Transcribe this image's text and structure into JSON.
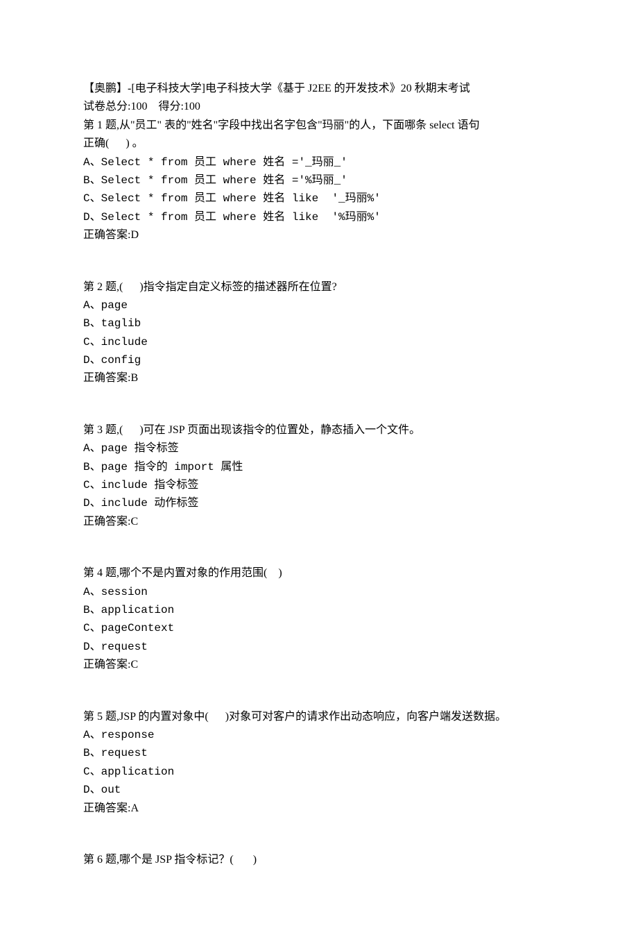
{
  "header": {
    "title": "【奥鹏】-[电子科技大学]电子科技大学《基于 J2EE 的开发技术》20 秋期末考试",
    "score_line": "试卷总分:100    得分:100"
  },
  "questions": [
    {
      "prompt_lines": [
        "第 1 题,从\"员工\" 表的\"姓名\"字段中找出名字包含\"玛丽\"的人，下面哪条 select 语句",
        "正确(      ) 。"
      ],
      "options": [
        "A、Select * from 员工 where 姓名 ='_玛丽_'",
        "B、Select * from 员工 where 姓名 ='%玛丽_'",
        "C、Select * from 员工 where 姓名 like  '_玛丽%'",
        "D、Select * from 员工 where 姓名 like  '%玛丽%'"
      ],
      "answer": "正确答案:D"
    },
    {
      "prompt_lines": [
        "第 2 题,(      )指令指定自定义标签的描述器所在位置?"
      ],
      "options": [
        "A、page",
        "B、taglib",
        "C、include",
        "D、config"
      ],
      "answer": "正确答案:B"
    },
    {
      "prompt_lines": [
        "第 3 题,(      )可在 JSP 页面出现该指令的位置处，静态插入一个文件。"
      ],
      "options": [
        "A、page 指令标签",
        "B、page 指令的 import 属性",
        "C、include 指令标签",
        "D、include 动作标签"
      ],
      "answer": "正确答案:C"
    },
    {
      "prompt_lines": [
        "第 4 题,哪个不是内置对象的作用范围(    )"
      ],
      "options": [
        "A、session",
        "B、application",
        "C、pageContext",
        "D、request"
      ],
      "answer": "正确答案:C"
    },
    {
      "prompt_lines": [
        "第 5 题,JSP 的内置对象中(      )对象可对客户的请求作出动态响应，向客户端发送数据。"
      ],
      "options": [
        "A、response",
        "B、request",
        "C、application",
        "D、out"
      ],
      "answer": "正确答案:A"
    },
    {
      "prompt_lines": [
        "第 6 题,哪个是 JSP 指令标记？(       )"
      ],
      "options": [],
      "answer": ""
    }
  ]
}
